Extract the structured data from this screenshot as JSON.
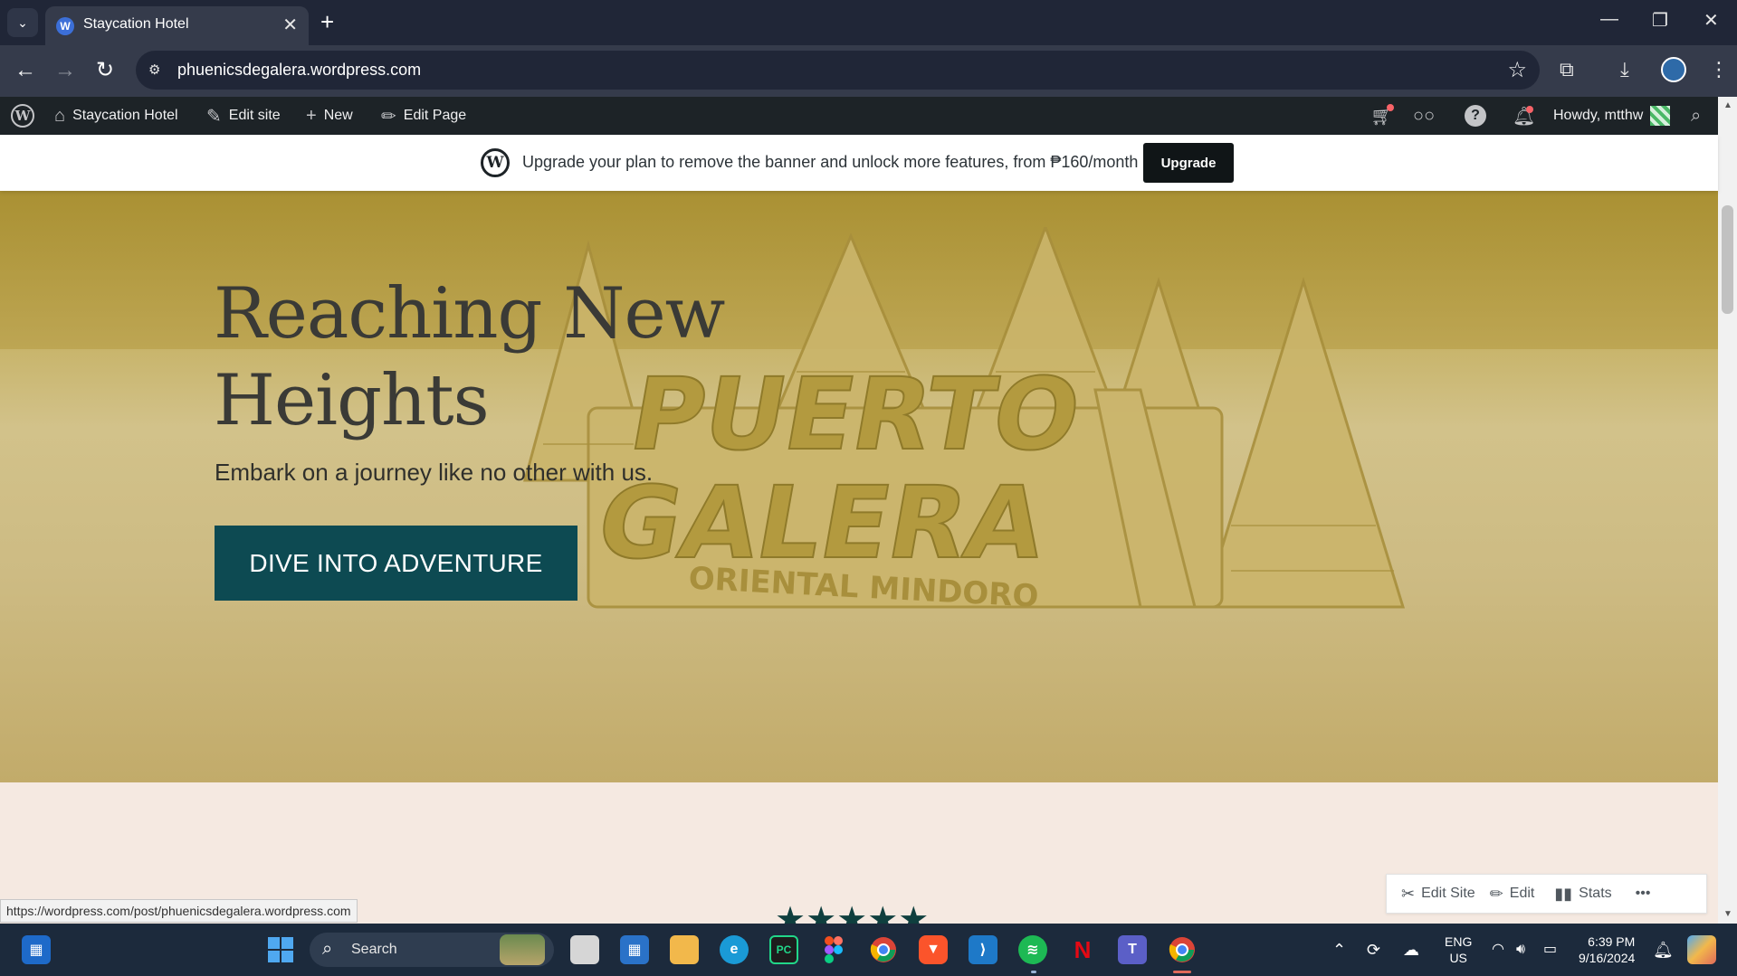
{
  "browser": {
    "tab_title": "Staycation Hotel",
    "url": "phuenicsdegalera.wordpress.com",
    "status_url": "https://wordpress.com/post/phuenicsdegalera.wordpress.com"
  },
  "wp_admin_bar": {
    "site_name": "Staycation Hotel",
    "edit_site": "Edit site",
    "new": "New",
    "edit_page": "Edit Page",
    "greeting": "Howdy, mtthw"
  },
  "banner": {
    "text": "Upgrade your plan to remove the banner and unlock more features, from ₱160/month",
    "button": "Upgrade"
  },
  "hero": {
    "title_line1": "Reaching New",
    "title_line2": "Heights",
    "subtitle": "Embark on a journey like no other with us.",
    "cta": "DIVE INTO ADVENTURE",
    "sign_line1": "PUERTO",
    "sign_line2": "GALERA",
    "sign_line3": "ORIENTAL MINDORO"
  },
  "rating": {
    "stars": "★★★★★",
    "value": 5,
    "max": 5
  },
  "floating_toolbar": {
    "edit_site": "Edit Site",
    "edit": "Edit",
    "stats": "Stats",
    "more": "•••"
  },
  "taskbar": {
    "search_label": "Search",
    "language": "ENG",
    "region": "US",
    "time": "6:39 PM",
    "date": "9/16/2024"
  },
  "colors": {
    "cta_bg": "#0d4a52",
    "hero_tint": "#c2ac58",
    "admin_bar": "#1d2327",
    "section_bg": "#f5e9e1",
    "stars": "#0f3f3e"
  }
}
